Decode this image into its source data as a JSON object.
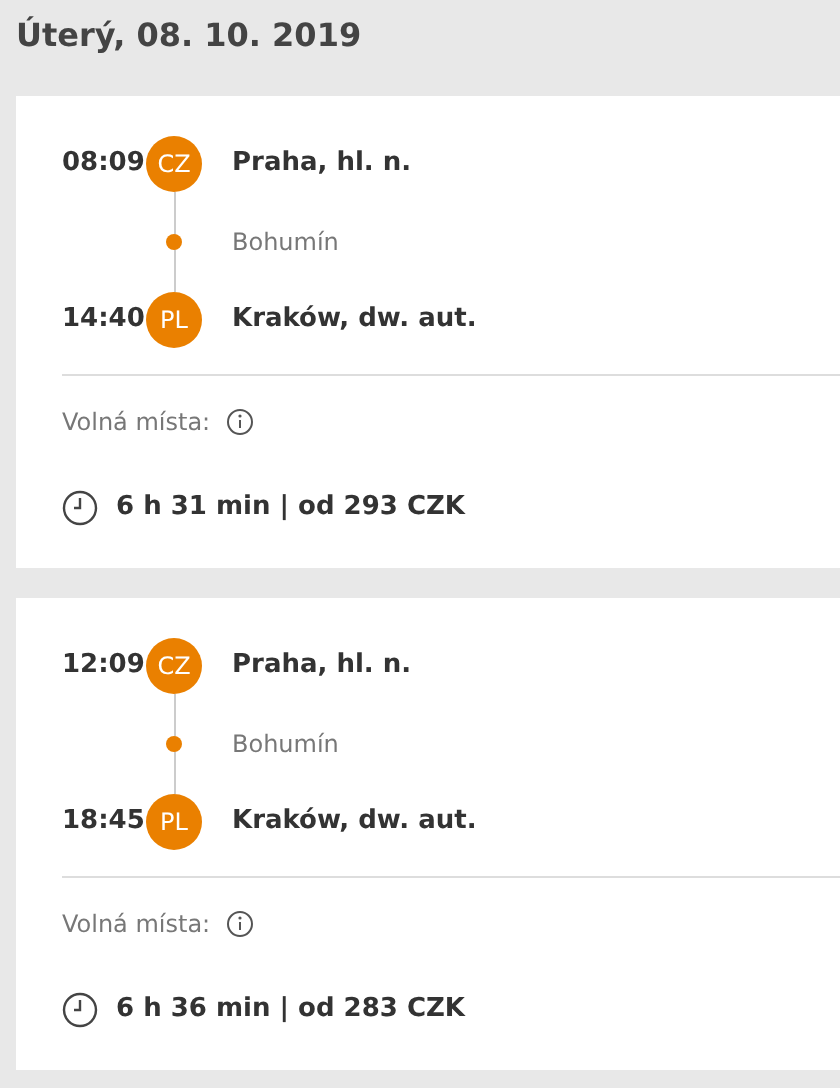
{
  "date_heading": "Úterý, 08. 10. 2019",
  "connections": [
    {
      "departure": {
        "time": "08:09",
        "country": "CZ",
        "station": "Praha, hl. n."
      },
      "stops": [
        "Bohumín"
      ],
      "arrival": {
        "time": "14:40",
        "country": "PL",
        "station": "Kraków, dw. aut."
      },
      "seats_label": "Volná místa:",
      "summary": "6 h 31 min | od 293 CZK"
    },
    {
      "departure": {
        "time": "12:09",
        "country": "CZ",
        "station": "Praha, hl. n."
      },
      "stops": [
        "Bohumín"
      ],
      "arrival": {
        "time": "18:45",
        "country": "PL",
        "station": "Kraków, dw. aut."
      },
      "seats_label": "Volná místa:",
      "summary": "6 h 36 min | od 283 CZK"
    }
  ]
}
